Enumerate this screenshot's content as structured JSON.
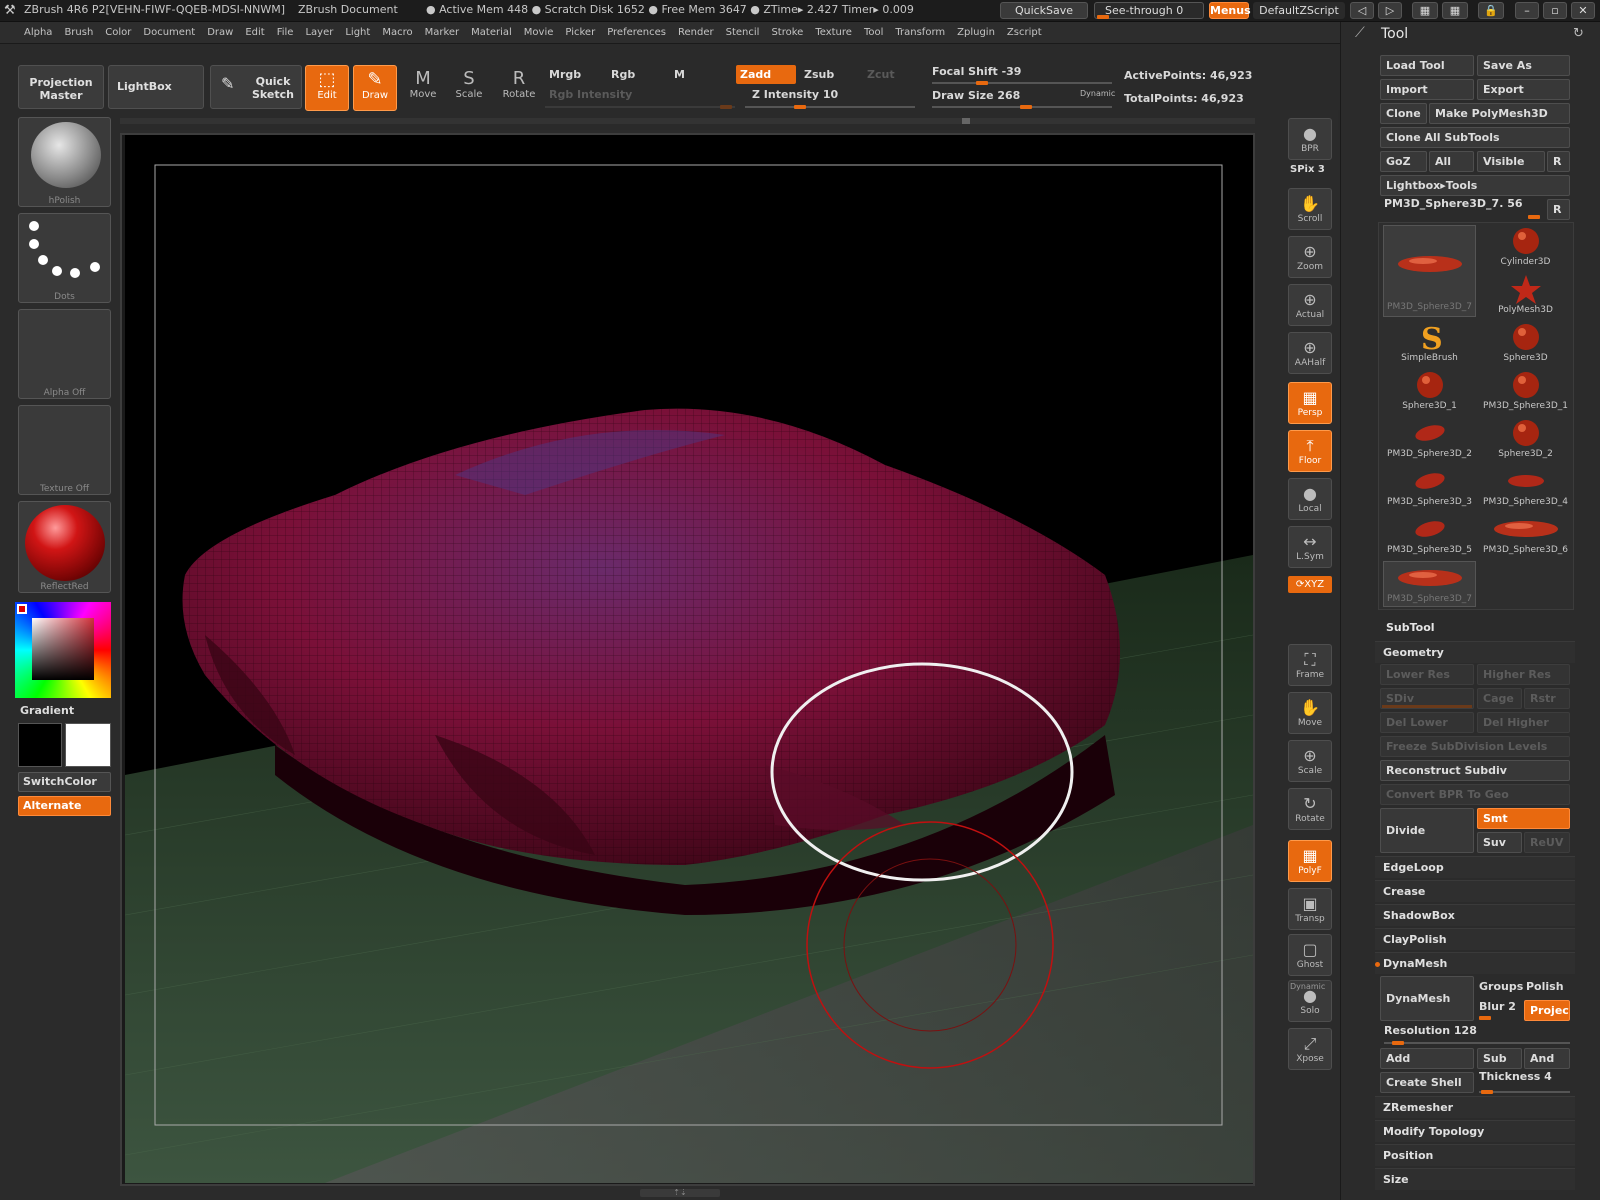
{
  "titlebar": {
    "app": "ZBrush 4R6 P2[VEHN-FIWF-QQEB-MDSI-NNWM]",
    "doc": "ZBrush Document",
    "stats": "● Active Mem 448 ● Scratch Disk 1652 ● Free Mem 3647 ● ZTime▸ 2.427 Timer▸ 0.009",
    "quicksave": "QuickSave",
    "see_through": "See-through  0",
    "menus": "Menus",
    "script": "DefaultZScript"
  },
  "menubar": [
    "Alpha",
    "Brush",
    "Color",
    "Document",
    "Draw",
    "Edit",
    "File",
    "Layer",
    "Light",
    "Macro",
    "Marker",
    "Material",
    "Movie",
    "Picker",
    "Preferences",
    "Render",
    "Stencil",
    "Stroke",
    "Texture",
    "Tool",
    "Transform",
    "Zplugin",
    "Zscript"
  ],
  "shelf": {
    "projection_master": "Projection Master",
    "lightbox": "LightBox",
    "quick_sketch": "Quick Sketch",
    "tools": [
      {
        "label": "Edit",
        "glyph": "⬚"
      },
      {
        "label": "Draw",
        "glyph": "✎"
      },
      {
        "label": "Move",
        "glyph": "M"
      },
      {
        "label": "Scale",
        "glyph": "S"
      },
      {
        "label": "Rotate",
        "glyph": "R"
      }
    ],
    "mrgb": "Mrgb",
    "rgb": "Rgb",
    "m": "M",
    "zadd": "Zadd",
    "zsub": "Zsub",
    "zcut": "Zcut",
    "rgb_intensity": "Rgb Intensity",
    "z_intensity": "Z Intensity 10",
    "focal_shift": "Focal Shift -39",
    "draw_size": "Draw Size 268",
    "dynamic": "Dynamic",
    "active_points": "ActivePoints: 46,923",
    "total_points": "TotalPoints: 46,923"
  },
  "lefttray": {
    "brush": "hPolish",
    "stroke": "Dots",
    "alpha": "Alpha  Off",
    "texture": "Texture  Off",
    "material": "ReflectRed",
    "gradient": "Gradient",
    "switchcolor": "SwitchColor",
    "alternate": "Alternate"
  },
  "rightdock": [
    {
      "label": "BPR",
      "glyph": "●",
      "on": false
    },
    {
      "label": "Scroll",
      "glyph": "✋",
      "on": false
    },
    {
      "label": "Zoom",
      "glyph": "⊕",
      "on": false
    },
    {
      "label": "Actual",
      "glyph": "⊕",
      "on": false
    },
    {
      "label": "AAHalf",
      "glyph": "⊕",
      "on": false
    },
    {
      "label": "Persp",
      "glyph": "▦",
      "on": true
    },
    {
      "label": "Floor",
      "glyph": "⤒",
      "on": true
    },
    {
      "label": "Local",
      "glyph": "●",
      "on": false
    },
    {
      "label": "L.Sym",
      "glyph": "↔",
      "on": false
    },
    {
      "label": "Frame",
      "glyph": "⛶",
      "on": false
    },
    {
      "label": "Move",
      "glyph": "✋",
      "on": false
    },
    {
      "label": "Scale",
      "glyph": "⊕",
      "on": false
    },
    {
      "label": "Rotate",
      "glyph": "↻",
      "on": false
    },
    {
      "label": "PolyF",
      "glyph": "▦",
      "on": true
    },
    {
      "label": "Transp",
      "glyph": "▣",
      "on": false
    },
    {
      "label": "Ghost",
      "glyph": "▢",
      "on": false
    },
    {
      "label": "Solo",
      "glyph": "●",
      "on": false
    },
    {
      "label": "Xpose",
      "glyph": "⤢",
      "on": false
    }
  ],
  "rightdock_extra": {
    "spix": "SPix 3",
    "xyz": "⟳XYZ",
    "dynamic": "Dynamic"
  },
  "toolpanel": {
    "title": "Tool",
    "load_tool": "Load Tool",
    "save_as": "Save As",
    "import": "Import",
    "export": "Export",
    "clone": "Clone",
    "make_polymesh": "Make PolyMesh3D",
    "clone_all": "Clone  All  SubTools",
    "goz": "GoZ",
    "all": "All",
    "visible": "Visible",
    "r": "R",
    "lightbox_tools": "Lightbox▸Tools",
    "current_tool": "PM3D_Sphere3D_7. 56",
    "tools": [
      {
        "name": "PM3D_Sphere3D_7",
        "shape": "flat"
      },
      {
        "name": "Cylinder3D",
        "shape": "ball"
      },
      {
        "name": "",
        "shape": "none"
      },
      {
        "name": "PolyMesh3D",
        "shape": "star"
      },
      {
        "name": "SimpleBrush",
        "shape": "s"
      },
      {
        "name": "Sphere3D",
        "shape": "ball"
      },
      {
        "name": "Sphere3D_1",
        "shape": "ball"
      },
      {
        "name": "PM3D_Sphere3D_1",
        "shape": "ball"
      },
      {
        "name": "PM3D_Sphere3D_2",
        "shape": "pill"
      },
      {
        "name": "Sphere3D_2",
        "shape": "ball"
      },
      {
        "name": "PM3D_Sphere3D_3",
        "shape": "pill"
      },
      {
        "name": "PM3D_Sphere3D_4",
        "shape": "oval"
      },
      {
        "name": "PM3D_Sphere3D_5",
        "shape": "pill"
      },
      {
        "name": "PM3D_Sphere3D_6",
        "shape": "flat"
      },
      {
        "name": "PM3D_Sphere3D_7",
        "shape": "flat"
      }
    ],
    "subtool": "SubTool",
    "geometry": "Geometry",
    "lower_res": "Lower Res",
    "higher_res": "Higher Res",
    "sdiv": "SDiv",
    "cage": "Cage",
    "rstr": "Rstr",
    "del_lower": "Del Lower",
    "del_higher": "Del Higher",
    "freeze": "Freeze SubDivision Levels",
    "reconstruct": "Reconstruct Subdiv",
    "convert_bpr": "Convert BPR To Geo",
    "divide": "Divide",
    "smt": "Smt",
    "suv": "Suv",
    "reuv": "ReUV",
    "edgeloop": "EdgeLoop",
    "crease": "Crease",
    "shadowbox": "ShadowBox",
    "claypolish": "ClayPolish",
    "dynamesh_head": "DynaMesh",
    "dynamesh": "DynaMesh",
    "groups": "Groups",
    "polish": "Polish",
    "blur": "Blur 2",
    "project": "Project",
    "resolution": "Resolution 128",
    "add": "Add",
    "sub": "Sub",
    "and": "And",
    "create_shell": "Create Shell",
    "thickness": "Thickness 4",
    "zremesher": "ZRemesher",
    "modify_topology": "Modify Topology",
    "position": "Position",
    "size": "Size"
  },
  "colors": {
    "accent": "#e8690f",
    "model": "#7a1030",
    "floor": "#3f5a3f"
  }
}
